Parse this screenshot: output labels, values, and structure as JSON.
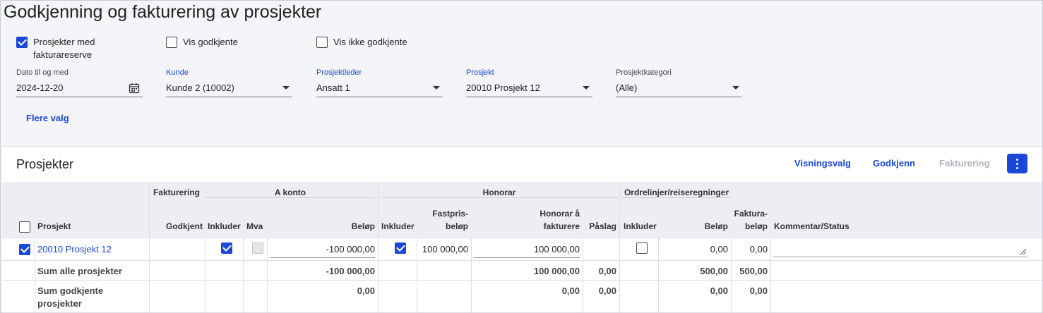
{
  "page": {
    "title": "Godkjenning og fakturering av prosjekter"
  },
  "filters": {
    "checkboxes": [
      {
        "label": "Prosjekter med fakturareserve",
        "checked": true
      },
      {
        "label": "Vis godkjente",
        "checked": false
      },
      {
        "label": "Vis ikke godkjente",
        "checked": false
      }
    ],
    "date": {
      "label": "Dato til og med",
      "value": "2024-12-20"
    },
    "customer": {
      "label": "Kunde",
      "value": "Kunde 2 (10002)"
    },
    "manager": {
      "label": "Prosjektleder",
      "value": "Ansatt 1"
    },
    "project": {
      "label": "Prosjekt",
      "value": "20010 Prosjekt 12"
    },
    "category": {
      "label": "Prosjektkategori",
      "value": "(Alle)"
    },
    "more_label": "Flere valg"
  },
  "panel": {
    "title": "Prosjekter",
    "actions": {
      "view_options": "Visningsvalg",
      "approve": "Godkjenn",
      "invoice": "Fakturering"
    }
  },
  "table": {
    "groups": {
      "invoicing": "Fakturering",
      "on_account": "A konto",
      "fee": "Honorar",
      "order_lines": "Ordrelinjer/reiseregninger"
    },
    "headers": {
      "project": "Prosjekt",
      "approved": "Godkjent",
      "ak_include": "Inkluder",
      "ak_vat": "Mva",
      "ak_amount": "Beløp",
      "h_include": "Inkluder",
      "h_fixed_1": "Fastpris-",
      "h_fixed_2": "beløp",
      "h_fee_1": "Honorar å",
      "h_fee_2": "fakturere",
      "h_markup": "Påslag",
      "o_include": "Inkluder",
      "o_amount": "Beløp",
      "inv_1": "Faktura-",
      "inv_2": "beløp",
      "comment": "Kommentar/Status"
    },
    "row": {
      "project": "20010 Prosjekt 12",
      "selected": true,
      "ak_include": true,
      "ak_vat": false,
      "ak_amount": "-100 000,00",
      "h_include": true,
      "h_fixed": "100 000,00",
      "h_fee": "100 000,00",
      "o_include": false,
      "o_amount": "0,00",
      "inv_amount": "0,00"
    },
    "sum_all": {
      "label": "Sum alle prosjekter",
      "ak_amount": "-100 000,00",
      "h_fee": "100 000,00",
      "h_markup": "0,00",
      "o_amount": "500,00",
      "inv_amount": "500,00"
    },
    "sum_approved": {
      "label_1": "Sum godkjente",
      "label_2": "prosjekter",
      "ak_amount": "0,00",
      "h_fee": "0,00",
      "h_markup": "0,00",
      "o_amount": "0,00",
      "inv_amount": "0,00"
    }
  }
}
